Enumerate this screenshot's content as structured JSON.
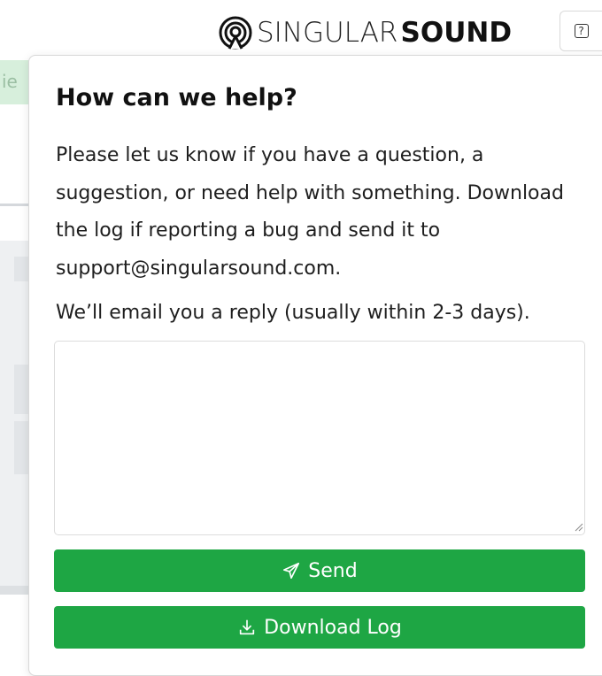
{
  "background": {
    "tab_text": "ie"
  },
  "header": {
    "brand_light": "SINGULAR",
    "brand_bold": "SOUND",
    "help_icon_glyph": "?"
  },
  "help_popover": {
    "title": "How can we help?",
    "description": "Please let us know if you have a question, a suggestion, or need help with something. Download the log if reporting a bug and send it to support@singularsound.com.",
    "note": "We’ll email you a reply (usually within 2-3 days).",
    "message_value": "",
    "send_label": "Send",
    "download_label": "Download Log"
  },
  "colors": {
    "button_green": "#1ea644",
    "background_tab_green": "#d7efdc"
  },
  "icons": {
    "brand": "singular-sound-logo-icon",
    "help": "question-square-icon",
    "send": "paper-plane-icon",
    "download": "download-tray-icon"
  }
}
